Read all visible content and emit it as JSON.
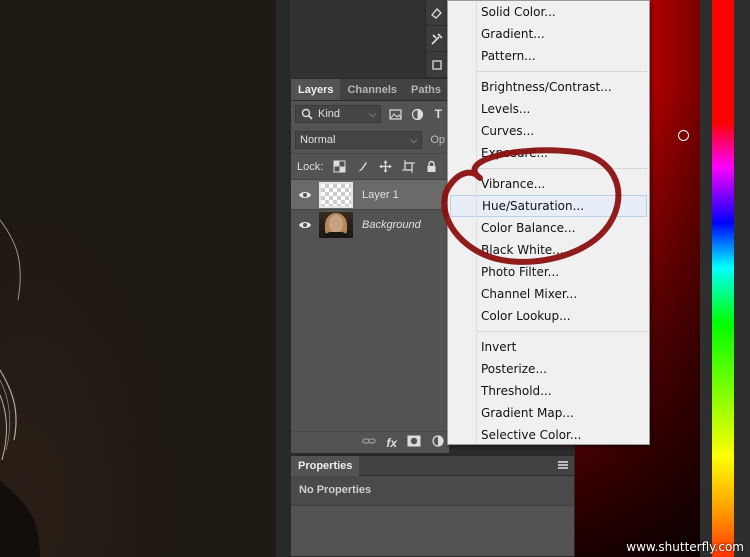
{
  "layers_panel": {
    "tabs": [
      "Layers",
      "Channels",
      "Paths"
    ],
    "filter_label": "Kind",
    "blend_mode": "Normal",
    "opacity_label": "Op",
    "lock_label": "Lock:",
    "layers": [
      {
        "name": "Layer 1",
        "thumb": "transparent"
      },
      {
        "name": "Background",
        "thumb": "photo"
      }
    ]
  },
  "properties_panel": {
    "tab": "Properties",
    "message": "No Properties"
  },
  "adjustment_menu": {
    "groups": [
      [
        "Solid Color...",
        "Gradient...",
        "Pattern..."
      ],
      [
        "Brightness/Contrast...",
        "Levels...",
        "Curves...",
        "Exposure..."
      ],
      [
        "Vibrance...",
        "Hue/Saturation...",
        "Color Balance...",
        "Black  White...",
        "Photo Filter...",
        "Channel Mixer...",
        "Color Lookup..."
      ],
      [
        "Invert",
        "Posterize...",
        "Threshold...",
        "Gradient Map...",
        "Selective Color..."
      ]
    ],
    "highlighted": "Hue/Saturation..."
  },
  "watermark": "www.shutterfly.com",
  "colors": {
    "annotation": "#8b1010",
    "panel_bg": "#535353",
    "menu_bg": "#f0f0f0",
    "picker_red": "#ff0000"
  },
  "icons": {
    "filter": "search-icon",
    "eye": "eye-icon",
    "link": "link-icon",
    "fx": "fx-icon",
    "mask": "mask-icon",
    "adjust": "adjustment-icon"
  }
}
